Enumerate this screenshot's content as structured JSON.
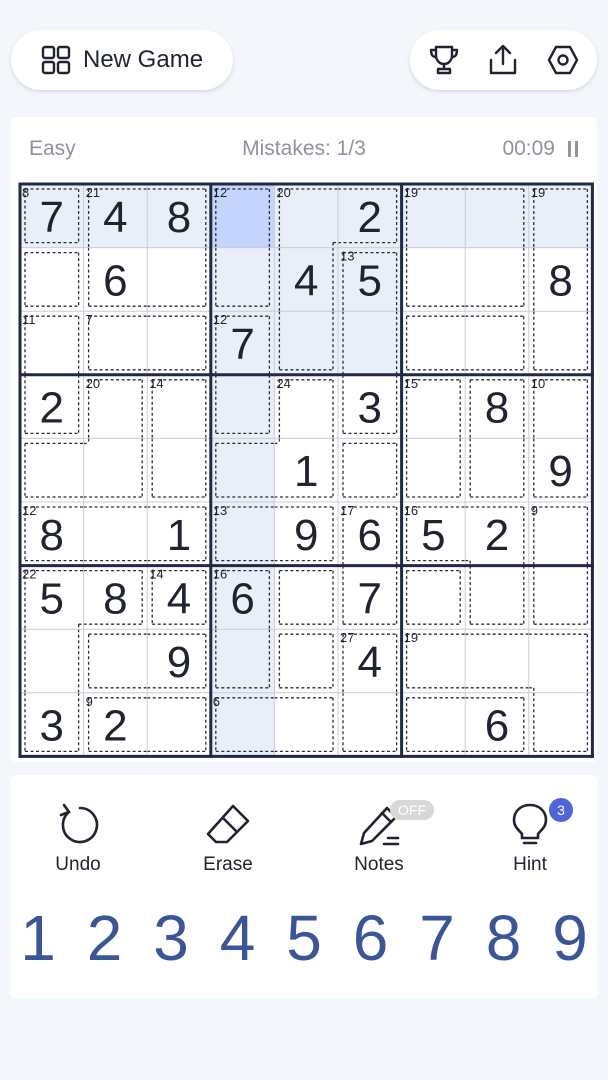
{
  "header": {
    "new_game_label": "New Game",
    "icons": [
      "grid-icon",
      "trophy-icon",
      "share-icon",
      "settings-icon"
    ]
  },
  "status": {
    "difficulty": "Easy",
    "mistakes": "Mistakes: 1/3",
    "timer": "00:09"
  },
  "board": {
    "values": [
      [
        7,
        4,
        8,
        0,
        0,
        2,
        0,
        0,
        0
      ],
      [
        0,
        6,
        0,
        0,
        4,
        5,
        0,
        0,
        8
      ],
      [
        0,
        0,
        0,
        7,
        0,
        0,
        0,
        0,
        0
      ],
      [
        2,
        0,
        0,
        0,
        0,
        3,
        0,
        8,
        0
      ],
      [
        0,
        0,
        0,
        0,
        1,
        0,
        0,
        0,
        9
      ],
      [
        8,
        0,
        1,
        0,
        9,
        6,
        5,
        2,
        0
      ],
      [
        5,
        8,
        4,
        6,
        0,
        7,
        0,
        0,
        0
      ],
      [
        0,
        0,
        9,
        0,
        0,
        4,
        0,
        0,
        0
      ],
      [
        3,
        2,
        0,
        0,
        0,
        0,
        0,
        6,
        0
      ]
    ],
    "selected": [
      0,
      3
    ],
    "cages": [
      {
        "sum": "8",
        "cells": [
          [
            0,
            0
          ]
        ]
      },
      {
        "sum": "21",
        "cells": [
          [
            0,
            1
          ],
          [
            1,
            1
          ],
          [
            0,
            2
          ],
          [
            1,
            2
          ]
        ]
      },
      {
        "sum": "12",
        "cells": [
          [
            0,
            3
          ],
          [
            1,
            3
          ]
        ]
      },
      {
        "sum": "20",
        "cells": [
          [
            0,
            4
          ],
          [
            1,
            4
          ],
          [
            2,
            4
          ],
          [
            0,
            5
          ]
        ]
      },
      {
        "sum": "19",
        "cells": [
          [
            0,
            6
          ],
          [
            1,
            6
          ],
          [
            0,
            7
          ],
          [
            1,
            7
          ]
        ]
      },
      {
        "sum": "19",
        "cells": [
          [
            0,
            8
          ],
          [
            1,
            8
          ],
          [
            2,
            8
          ]
        ]
      },
      {
        "sum": "",
        "cells": [
          [
            1,
            0
          ]
        ]
      },
      {
        "sum": "13",
        "cells": [
          [
            1,
            5
          ],
          [
            2,
            5
          ],
          [
            3,
            5
          ]
        ]
      },
      {
        "sum": "11",
        "cells": [
          [
            2,
            0
          ],
          [
            3,
            0
          ]
        ]
      },
      {
        "sum": "7",
        "cells": [
          [
            2,
            1
          ],
          [
            2,
            2
          ]
        ]
      },
      {
        "sum": "12",
        "cells": [
          [
            2,
            3
          ],
          [
            3,
            3
          ]
        ]
      },
      {
        "sum": "",
        "cells": [
          [
            2,
            6
          ],
          [
            2,
            7
          ]
        ]
      },
      {
        "sum": "20",
        "cells": [
          [
            3,
            1
          ],
          [
            4,
            1
          ],
          [
            4,
            0
          ]
        ]
      },
      {
        "sum": "14",
        "cells": [
          [
            3,
            2
          ],
          [
            4,
            2
          ]
        ]
      },
      {
        "sum": "24",
        "cells": [
          [
            3,
            4
          ],
          [
            4,
            3
          ],
          [
            4,
            4
          ]
        ]
      },
      {
        "sum": "15",
        "cells": [
          [
            3,
            6
          ],
          [
            4,
            6
          ]
        ]
      },
      {
        "sum": "",
        "cells": [
          [
            3,
            7
          ],
          [
            4,
            7
          ]
        ]
      },
      {
        "sum": "10",
        "cells": [
          [
            3,
            8
          ],
          [
            4,
            8
          ]
        ]
      },
      {
        "sum": "",
        "cells": [
          [
            4,
            5
          ]
        ]
      },
      {
        "sum": "12",
        "cells": [
          [
            5,
            0
          ],
          [
            5,
            1
          ],
          [
            5,
            2
          ]
        ]
      },
      {
        "sum": "13",
        "cells": [
          [
            5,
            3
          ],
          [
            5,
            4
          ]
        ]
      },
      {
        "sum": "17",
        "cells": [
          [
            5,
            5
          ],
          [
            6,
            5
          ]
        ]
      },
      {
        "sum": "16",
        "cells": [
          [
            5,
            6
          ],
          [
            5,
            7
          ],
          [
            6,
            7
          ]
        ]
      },
      {
        "sum": "9",
        "cells": [
          [
            5,
            8
          ],
          [
            6,
            8
          ]
        ]
      },
      {
        "sum": "22",
        "cells": [
          [
            6,
            0
          ],
          [
            6,
            1
          ],
          [
            7,
            0
          ],
          [
            8,
            0
          ]
        ]
      },
      {
        "sum": "14",
        "cells": [
          [
            6,
            2
          ]
        ]
      },
      {
        "sum": "16",
        "cells": [
          [
            6,
            3
          ],
          [
            7,
            3
          ]
        ]
      },
      {
        "sum": "",
        "cells": [
          [
            6,
            4
          ]
        ]
      },
      {
        "sum": "",
        "cells": [
          [
            6,
            6
          ]
        ]
      },
      {
        "sum": "",
        "cells": [
          [
            7,
            1
          ],
          [
            7,
            2
          ]
        ]
      },
      {
        "sum": "",
        "cells": [
          [
            7,
            4
          ]
        ]
      },
      {
        "sum": "27",
        "cells": [
          [
            7,
            5
          ],
          [
            8,
            5
          ]
        ]
      },
      {
        "sum": "19",
        "cells": [
          [
            7,
            6
          ],
          [
            7,
            7
          ],
          [
            7,
            8
          ],
          [
            8,
            8
          ]
        ]
      },
      {
        "sum": "9",
        "cells": [
          [
            8,
            1
          ],
          [
            8,
            2
          ]
        ]
      },
      {
        "sum": "6",
        "cells": [
          [
            8,
            3
          ],
          [
            8,
            4
          ]
        ]
      },
      {
        "sum": "",
        "cells": [
          [
            8,
            6
          ],
          [
            8,
            7
          ]
        ]
      }
    ]
  },
  "tools": {
    "undo": "Undo",
    "erase": "Erase",
    "notes": "Notes",
    "notes_state": "OFF",
    "hint": "Hint",
    "hint_count": "3"
  },
  "numpad": [
    "1",
    "2",
    "3",
    "4",
    "5",
    "6",
    "7",
    "8",
    "9"
  ],
  "colors": {
    "selected": "#c4d4fc",
    "highlight": "#eaeef8",
    "number": "#3a5699",
    "given": "#1f2430",
    "badge": "#4e64d8"
  }
}
